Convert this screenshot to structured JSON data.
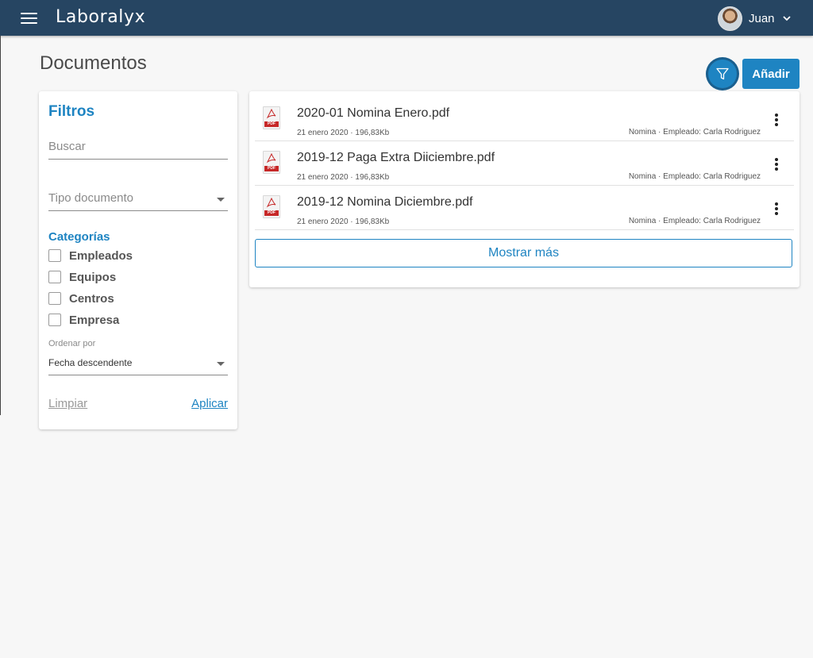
{
  "header": {
    "brand": "Laboralyx",
    "user_name": "Juan"
  },
  "page": {
    "title": "Documentos",
    "add_label": "Añadir"
  },
  "filters": {
    "title": "Filtros",
    "search_placeholder": "Buscar",
    "doc_type_placeholder": "Tipo documento",
    "categories_title": "Categorías",
    "categories": [
      "Empleados",
      "Equipos",
      "Centros",
      "Empresa"
    ],
    "sort_label": "Ordenar por",
    "sort_value": "Fecha descendente",
    "clear_label": "Limpiar",
    "apply_label": "Aplicar"
  },
  "documents": [
    {
      "name": "2020-01 Nomina Enero.pdf",
      "meta": "21 enero 2020 · 196,83Kb",
      "tags": "Nomina · Empleado: Carla Rodriguez"
    },
    {
      "name": "2019-12 Paga Extra Diiciembre.pdf",
      "meta": "21 enero 2020 · 196,83Kb",
      "tags": "Nomina · Empleado: Carla Rodriguez"
    },
    {
      "name": "2019-12 Nomina Diciembre.pdf",
      "meta": "21 enero 2020 · 196,83Kb",
      "tags": "Nomina · Empleado: Carla Rodriguez"
    }
  ],
  "show_more_label": "Mostrar más",
  "icons": {
    "menu": "menu-icon",
    "filter": "filter-icon",
    "user_dropdown": "chevron-down-icon",
    "document": "pdf-file-icon",
    "row_actions": "more-vertical-icon"
  },
  "colors": {
    "topbar": "#264562",
    "accent": "#1e84c2",
    "background": "#f7f7f7"
  }
}
